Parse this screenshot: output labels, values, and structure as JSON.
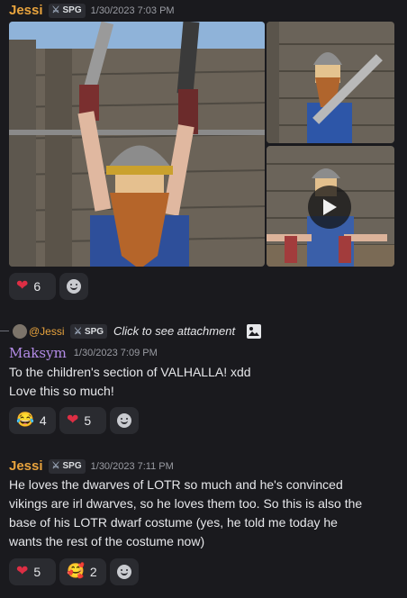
{
  "message1": {
    "username": "Jessi",
    "tag": "SPG",
    "timestamp": "1/30/2023 7:03 PM",
    "reactions": [
      {
        "emoji": "heart",
        "count": "6"
      }
    ]
  },
  "reply": {
    "mention": "@Jessi",
    "tag": "SPG",
    "text": "Click to see attachment"
  },
  "message2": {
    "username": "Maksym",
    "timestamp": "1/30/2023 7:09 PM",
    "lines": [
      "To the children's section of VALHALLA! xdd",
      "Love this so much!"
    ],
    "reactions": [
      {
        "emoji": "joy",
        "count": "4"
      },
      {
        "emoji": "heart",
        "count": "5"
      }
    ]
  },
  "message3": {
    "username": "Jessi",
    "tag": "SPG",
    "timestamp": "1/30/2023 7:11 PM",
    "lines": [
      "He loves the dwarves of LOTR so much and he's convinced",
      "vikings are irl dwarves, so he loves them too. So this is also the",
      "base of his LOTR dwarf costume (yes, he told me today he",
      "wants the rest of the costume now)"
    ],
    "reactions": [
      {
        "emoji": "heart",
        "count": "5"
      },
      {
        "emoji": "smiling-face-with-hearts",
        "count": "2"
      }
    ]
  },
  "colors": {
    "background": "#1a1a1e",
    "jessi_name": "#e8a33d",
    "maksym_name": "#b48ce8",
    "reaction_bg": "#2a2b30"
  }
}
